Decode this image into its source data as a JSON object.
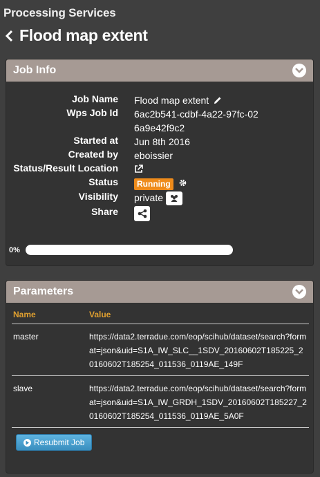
{
  "app": {
    "section_title": "Processing Services"
  },
  "page": {
    "title": "Flood map extent"
  },
  "job_info": {
    "panel_title": "Job Info",
    "labels": {
      "job_name": "Job Name",
      "wps_job_id": "Wps Job Id",
      "started_at": "Started at",
      "created_by": "Created by",
      "status_location": "Status/Result Location",
      "status": "Status",
      "visibility": "Visibility",
      "share": "Share"
    },
    "values": {
      "job_name": "Flood map extent",
      "wps_job_id": "6ac2b541-cdbf-4a22-97fc-026a9e42f9c2",
      "started_at": "Jun 8th 2016",
      "created_by": "eboissier",
      "status": "Running",
      "visibility": "private"
    },
    "progress": {
      "label": "0%",
      "value": 0
    }
  },
  "parameters": {
    "panel_title": "Parameters",
    "columns": [
      "Name",
      "Value"
    ],
    "rows": [
      {
        "name": "master",
        "value": "https://data2.terradue.com/eop/scihub/dataset/search?format=json&uid=S1A_IW_SLC__1SDV_20160602T185225_20160602T185254_011536_0119AE_149F"
      },
      {
        "name": "slave",
        "value": "https://data2.terradue.com/eop/scihub/dataset/search?format=json&uid=S1A_IW_GRDH_1SDV_20160602T185227_20160602T185254_011536_0119AE_5A0F"
      }
    ],
    "resubmit_label": "Resubmit Job"
  },
  "icons": {
    "back": "chevron-left-icon",
    "collapse": "chevron-down-icon",
    "edit": "pencil-icon",
    "external_link": "external-link-icon",
    "settings": "gear-icon",
    "group": "users-icon",
    "share": "share-icon",
    "play": "play-circle-icon"
  },
  "colors": {
    "background": "#3f3f3f",
    "panel_header": "#a69a94",
    "status_running": "#ee8b1b",
    "table_header": "#e0a030",
    "button": "#3a8fbf"
  }
}
